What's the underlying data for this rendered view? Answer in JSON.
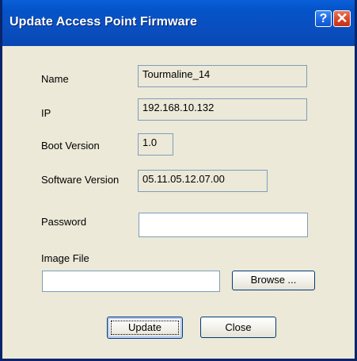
{
  "window": {
    "title": "Update Access Point Firmware",
    "help_glyph": "?",
    "close_glyph": "✕"
  },
  "fields": {
    "name_label": "Name",
    "name_value": "Tourmaline_14",
    "ip_label": "IP",
    "ip_value": "192.168.10.132",
    "boot_version_label": "Boot Version",
    "boot_version_value": "1.0",
    "software_version_label": "Software Version",
    "software_version_value": "05.11.05.12.07.00",
    "password_label": "Password",
    "password_value": "",
    "image_file_label": "Image File",
    "image_file_value": ""
  },
  "buttons": {
    "browse_label": "Browse ...",
    "update_label": "Update",
    "close_label": "Close"
  },
  "colors": {
    "titlebar": "#0453c8",
    "dialog_background": "#ece9d8",
    "field_border": "#7f9db9",
    "button_border": "#003c74",
    "close_button": "#d8452a"
  },
  "icons": {
    "help": "question-mark-icon",
    "close": "close-x-icon"
  }
}
